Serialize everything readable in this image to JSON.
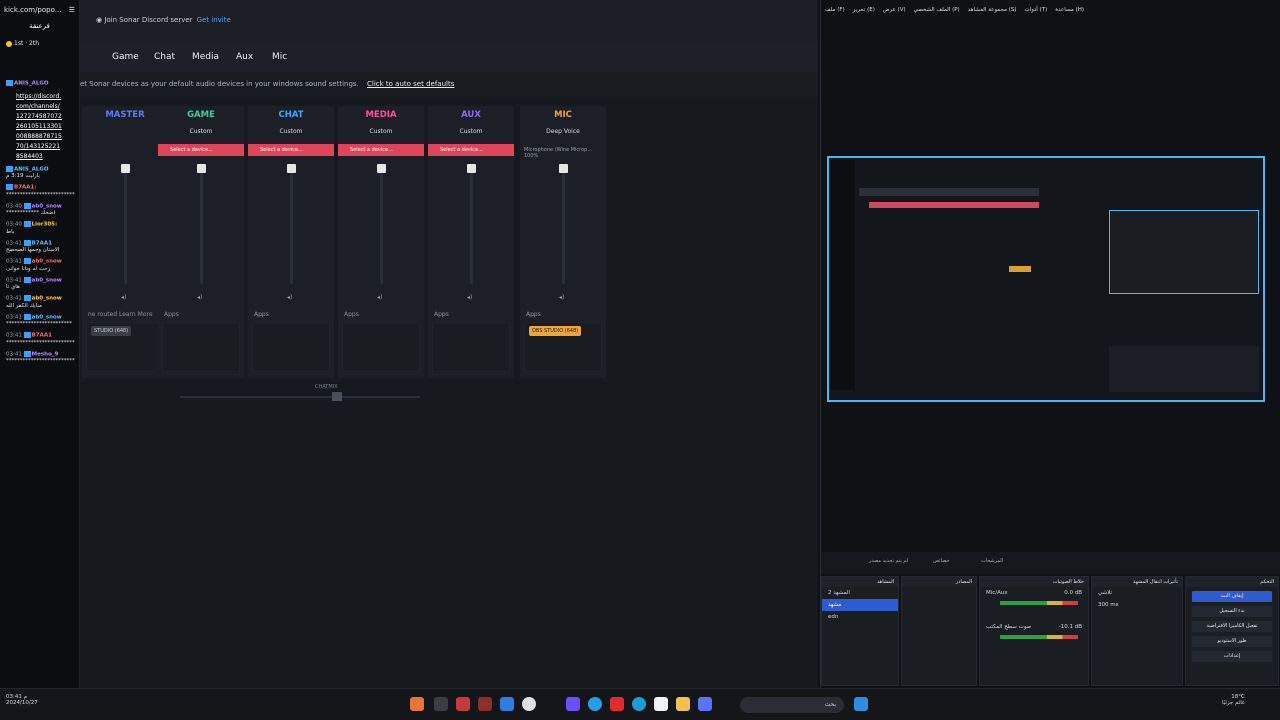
{
  "chat": {
    "url": "kick.com/popo...",
    "header": "فرعنقة",
    "messages": [
      {
        "time": "",
        "user": "ANIS_ALGO",
        "text": ""
      },
      {
        "time": "",
        "user": "",
        "text": "https://discord.com/channels/12727458707226010511330100888887871570/1431252218584403"
      },
      {
        "time": "",
        "user": "ANIS_ALGO",
        "text": "بازليت 3:19 م"
      },
      {
        "time": "",
        "user": "B7AA1:",
        "text": "*************************"
      },
      {
        "time": "03:40",
        "user": "ab0_snow",
        "text": "************ اضحك"
      },
      {
        "time": "03:40",
        "user": "Lior305:",
        "text": "باط"
      },
      {
        "time": "03:41",
        "user": "B7AA1",
        "text": "الاستان وجمها الضحضح"
      },
      {
        "time": "03:41",
        "user": "ab0_snow",
        "text": "زحث له ونانا خوانى"
      },
      {
        "time": "03:41",
        "user": "ab0_snow",
        "text": "هاي تا"
      },
      {
        "time": "03:41",
        "user": "ab0_snow",
        "text": "منايك الكفر الله"
      },
      {
        "time": "03:41",
        "user": "ab0_snow",
        "text": "************************"
      },
      {
        "time": "03:41",
        "user": "B7AA1",
        "text": "*************************"
      },
      {
        "time": "03:41",
        "user": "Mesho_9",
        "text": "*************************"
      }
    ]
  },
  "sonar": {
    "discord_text": "Join Sonar Discord server",
    "discord_link": "Get invite",
    "tabs": [
      "Game",
      "Chat",
      "Media",
      "Aux",
      "Mic"
    ],
    "hint": "et Sonar devices as your default audio devices in your windows sound settings.",
    "hint_link": "Click to auto set defaults",
    "channels": [
      {
        "name": "MASTER",
        "color": "#5b7cff",
        "mode": "",
        "device": "",
        "apps": "ne routed   Learn More",
        "chip": "STUDIO (648)"
      },
      {
        "name": "GAME",
        "color": "#35d0a0",
        "mode": "Custom",
        "device": "Select a device...",
        "apps": "Apps",
        "chip": ""
      },
      {
        "name": "CHAT",
        "color": "#3aa6ff",
        "mode": "Custom",
        "device": "Select a device...",
        "apps": "Apps",
        "chip": ""
      },
      {
        "name": "MEDIA",
        "color": "#ff4f9a",
        "mode": "Custom",
        "device": "Select a device...",
        "apps": "Apps",
        "chip": ""
      },
      {
        "name": "AUX",
        "color": "#8f6bff",
        "mode": "Custom",
        "device": "Select a device...",
        "apps": "Apps",
        "chip": ""
      },
      {
        "name": "MIC",
        "color": "#f0a53a",
        "mode": "Deep Voice",
        "device": "Microphone (Wine Microp... 100%",
        "apps": "Apps",
        "chip": "OBS STUDIO (648)"
      }
    ],
    "chatmix_label": "CHATMIX"
  },
  "obs": {
    "menu": [
      "ملف (F)",
      "تحرير (E)",
      "عرض (V)",
      "الملف الشخصي (P)",
      "مجموعة المشاهد (S)",
      "أدوات (T)",
      "مساعدة (H)"
    ],
    "controls": [
      "لم يتم تحديد مصدر",
      "خصائص",
      "المرشحات"
    ],
    "docks": {
      "scenes_title": "المشاهد",
      "scenes": [
        "المشهد 2",
        "مشهد",
        "edn"
      ],
      "sources_title": "المصادر",
      "mixer_title": "خلاط الصوتيات",
      "mixer": [
        {
          "name": "Mic/Aux",
          "db": "0.0 dB"
        },
        {
          "name": "صوت سطح المكتب",
          "db": "-10.1 dB"
        }
      ],
      "transitions_title": "تأثيرات انتقال المشهد",
      "transition": "تلاشي",
      "duration": "300 ms",
      "controls_title": "التحكم",
      "buttons": [
        "إيقاف البث",
        "بدء التسجيل",
        "تفعيل الكاميرا الافتراضية",
        "طور الاستوديو",
        "إعدادات"
      ]
    }
  },
  "taskbar": {
    "search": "بحث",
    "time": "03:41 م",
    "date": "2024/10/27",
    "weather": "18°C",
    "weather_desc": "غائم جزئيًا"
  }
}
